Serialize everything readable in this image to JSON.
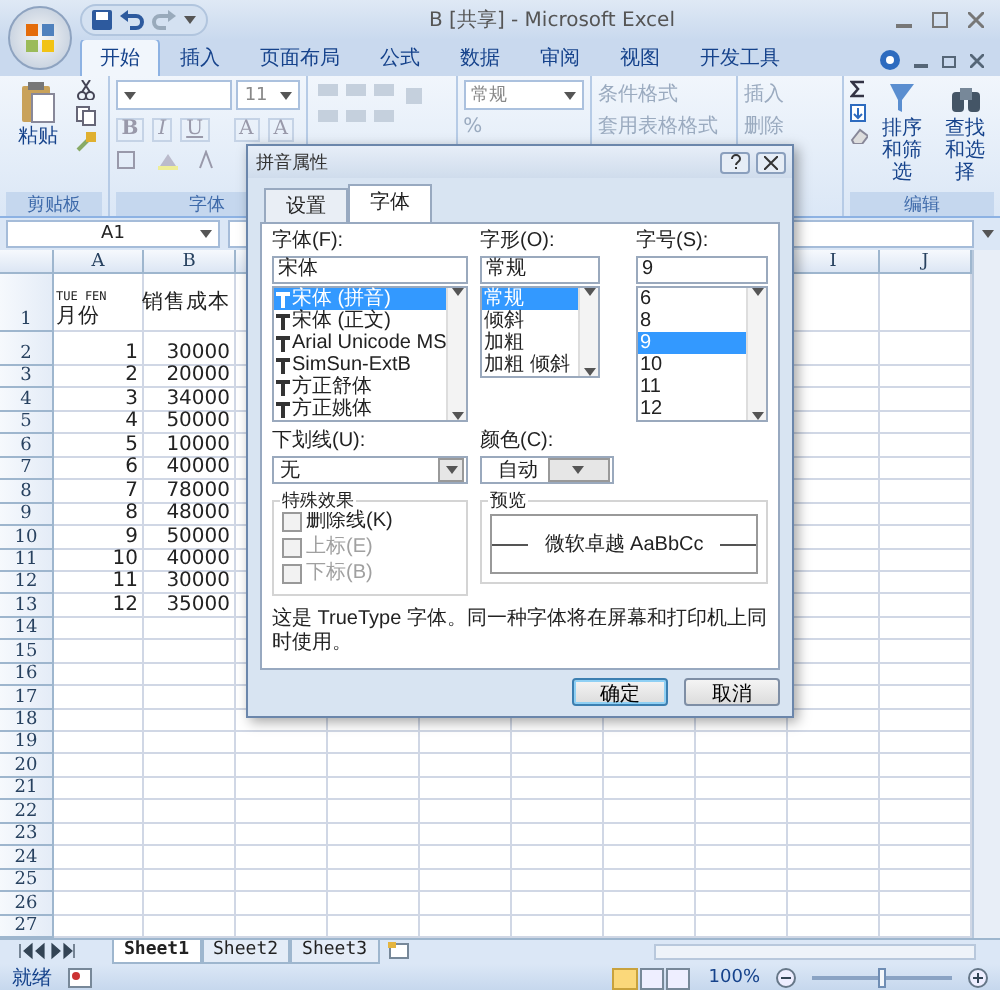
{
  "window": {
    "title": "B [共享] - Microsoft Excel"
  },
  "ribbon_tabs": [
    {
      "label": "开始",
      "selected": true
    },
    {
      "label": "插入",
      "selected": false
    },
    {
      "label": "页面布局",
      "selected": false
    },
    {
      "label": "公式",
      "selected": false
    },
    {
      "label": "数据",
      "selected": false
    },
    {
      "label": "审阅",
      "selected": false
    },
    {
      "label": "视图",
      "selected": false
    },
    {
      "label": "开发工具",
      "selected": false
    }
  ],
  "ribbon": {
    "clipboard": {
      "paste": "粘贴",
      "label": "剪贴板"
    },
    "font": {
      "size": "11",
      "label": "字体",
      "format_buttons": [
        "B",
        "I",
        "U",
        "A",
        "A"
      ]
    },
    "number": {
      "format": "常规",
      "percent": "%"
    },
    "styles": {
      "conditional": "条件格式",
      "table": "套用表格格式"
    },
    "cells": {
      "insert": "插入",
      "delete": "删除"
    },
    "editing": {
      "sort": "排序和筛选",
      "find": "查找和选择",
      "label": "编辑"
    }
  },
  "name_box": "A1",
  "left_columns": [
    "A",
    "B"
  ],
  "right_columns": [
    "I",
    "J"
  ],
  "rows": [
    {
      "number": "1",
      "a_caption": "TUE FEN",
      "a": "月份",
      "b": "销售成本"
    },
    {
      "number": "2",
      "a": "1",
      "b": "30000"
    },
    {
      "number": "3",
      "a": "2",
      "b": "20000"
    },
    {
      "number": "4",
      "a": "3",
      "b": "34000"
    },
    {
      "number": "5",
      "a": "4",
      "b": "50000"
    },
    {
      "number": "6",
      "a": "5",
      "b": "10000"
    },
    {
      "number": "7",
      "a": "6",
      "b": "40000"
    },
    {
      "number": "8",
      "a": "7",
      "b": "78000"
    },
    {
      "number": "9",
      "a": "8",
      "b": "48000"
    },
    {
      "number": "10",
      "a": "9",
      "b": "50000"
    },
    {
      "number": "11",
      "a": "10",
      "b": "40000"
    },
    {
      "number": "12",
      "a": "11",
      "b": "30000"
    },
    {
      "number": "13",
      "a": "12",
      "b": "35000"
    },
    {
      "number": "14"
    },
    {
      "number": "15"
    },
    {
      "number": "16"
    },
    {
      "number": "17"
    },
    {
      "number": "18"
    },
    {
      "number": "19"
    },
    {
      "number": "20"
    },
    {
      "number": "21"
    },
    {
      "number": "22"
    },
    {
      "number": "23"
    },
    {
      "number": "24"
    },
    {
      "number": "25"
    },
    {
      "number": "26"
    },
    {
      "number": "27"
    }
  ],
  "sheet_tabs": [
    {
      "label": "Sheet1",
      "selected": true
    },
    {
      "label": "Sheet2",
      "selected": false
    },
    {
      "label": "Sheet3",
      "selected": false
    }
  ],
  "status_bar": {
    "text": "就绪",
    "zoom": "100%",
    "level": 0.5
  },
  "dialog": {
    "title": "拼音属性",
    "tabs": [
      {
        "label": "设置",
        "selected": false
      },
      {
        "label": "字体",
        "selected": true
      }
    ],
    "font": {
      "label": "字体(F):",
      "value": "宋体",
      "items": [
        {
          "label": "宋体 (拼音)",
          "selected": true
        },
        {
          "label": "宋体 (正文)",
          "selected": false
        },
        {
          "label": "Arial Unicode MS",
          "selected": false
        },
        {
          "label": "SimSun-ExtB",
          "selected": false
        },
        {
          "label": "方正舒体",
          "selected": false
        },
        {
          "label": "方正姚体",
          "selected": false
        }
      ]
    },
    "style": {
      "label": "字形(O):",
      "value": "常规",
      "items": [
        {
          "label": "常规",
          "selected": true
        },
        {
          "label": "倾斜",
          "selected": false
        },
        {
          "label": "加粗",
          "selected": false
        },
        {
          "label": "加粗 倾斜",
          "selected": false
        }
      ]
    },
    "size": {
      "label": "字号(S):",
      "value": "9",
      "items": [
        {
          "label": "6",
          "selected": false
        },
        {
          "label": "8",
          "selected": false
        },
        {
          "label": "9",
          "selected": true
        },
        {
          "label": "10",
          "selected": false
        },
        {
          "label": "11",
          "selected": false
        },
        {
          "label": "12",
          "selected": false
        }
      ]
    },
    "underline": {
      "label": "下划线(U):",
      "value": "无"
    },
    "color": {
      "label": "颜色(C):",
      "value": "自动"
    },
    "effects": {
      "label": "特殊效果",
      "items": [
        {
          "label": "删除线(K)",
          "checked": false,
          "disabled": false
        },
        {
          "label": "上标(E)",
          "checked": false,
          "disabled": true
        },
        {
          "label": "下标(B)",
          "checked": false,
          "disabled": true
        }
      ]
    },
    "preview": {
      "label": "预览",
      "sample": "微软卓越 AaBbCc"
    },
    "note": "这是 TrueType 字体。同一种字体将在屏幕和打印机上同时使用。",
    "buttons": [
      "确定",
      "取消"
    ]
  }
}
